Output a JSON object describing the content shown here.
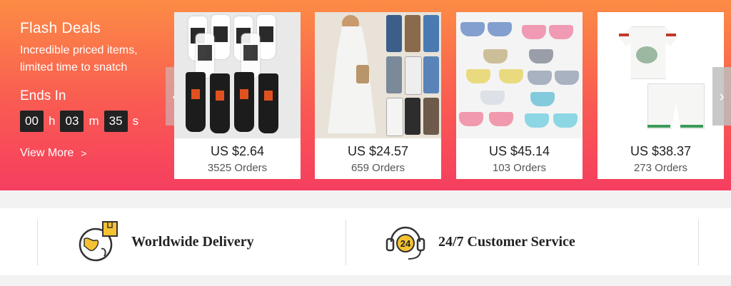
{
  "flash_deals": {
    "title": "Flash Deals",
    "subtitle": "Incredible priced items, limited time to snatch",
    "ends_label": "Ends In",
    "countdown": {
      "hours": "00",
      "hours_unit": "h",
      "minutes": "03",
      "minutes_unit": "m",
      "seconds": "35",
      "seconds_unit": "s"
    },
    "view_more": "View More",
    "view_more_icon": "chevron-right-icon"
  },
  "products": [
    {
      "price": "US $2.64",
      "orders": "3525 Orders",
      "image": "socks"
    },
    {
      "price": "US $24.57",
      "orders": "659 Orders",
      "image": "printed-dress"
    },
    {
      "price": "US $45.14",
      "orders": "103 Orders",
      "image": "rimless-sunglasses"
    },
    {
      "price": "US $38.37",
      "orders": "273 Orders",
      "image": "casablanca-shirt-set"
    }
  ],
  "features": [
    {
      "label": "Worldwide Delivery",
      "icon": "globe-box-icon"
    },
    {
      "label": "24/7 Customer Service",
      "icon": "headset-24-icon",
      "icon_text": "24"
    }
  ],
  "colors": {
    "banner_top": "#fc8c45",
    "banner_bottom": "#f63e60",
    "icon_yellow": "#f6c233"
  }
}
